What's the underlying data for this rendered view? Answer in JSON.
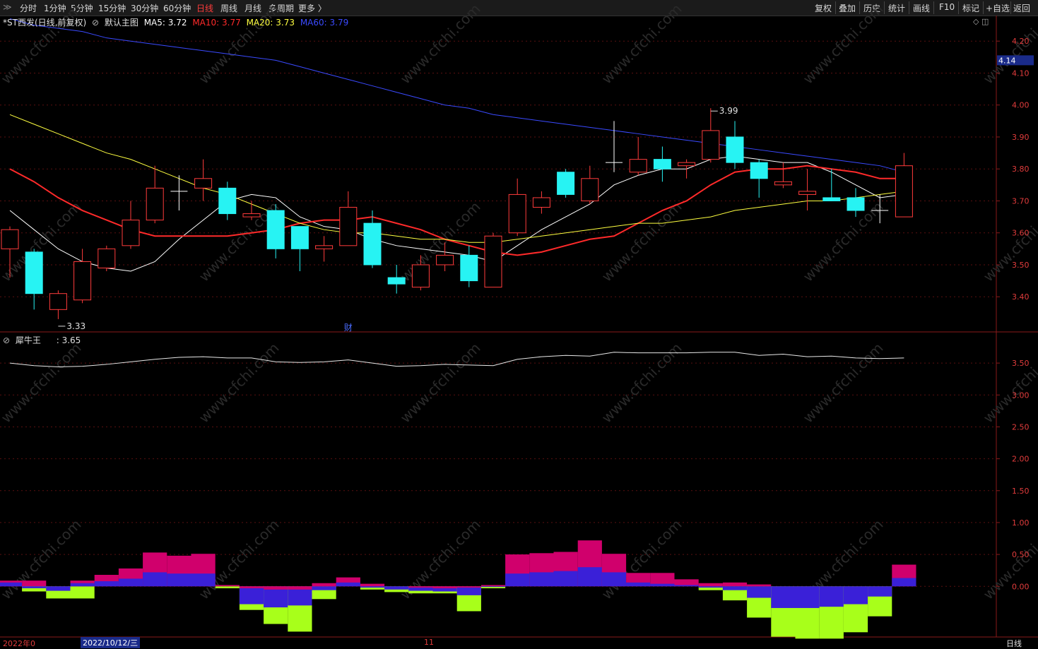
{
  "toolbar": {
    "left_tabs": [
      "分时",
      "1分钟",
      "5分钟",
      "15分钟",
      "30分钟",
      "60分钟",
      "日线",
      "周线",
      "月线",
      "多周期",
      "更多 〉"
    ],
    "active_tab": "日线",
    "right_tabs": [
      "复权",
      "叠加",
      "历史",
      "统计",
      "画线",
      "F10",
      "标记",
      "+自选",
      "返回"
    ]
  },
  "main_legend": {
    "title": "*ST西发(日线,前复权)",
    "template": "默认主图",
    "ma5": "MA5: 3.72",
    "ma10": "MA10: 3.77",
    "ma20": "MA20: 3.73",
    "ma60": "MA60: 3.79",
    "colors": {
      "ma5": "#ffffff",
      "ma10": "#ff2a2a",
      "ma20": "#ffff40",
      "ma60": "#3a4aff"
    }
  },
  "indicator_legend": {
    "name": "犀牛王",
    "value": ": 3.65"
  },
  "annotations": {
    "low_label": "3.33",
    "high_label": "3.99",
    "finance_marker": "财",
    "current_price_tag": "4.14"
  },
  "bottom_bar": {
    "left_date": "2022年0",
    "cursor_date": "2022/10/12/三",
    "month_mark": "11",
    "period": "日线"
  },
  "watermark": "www.cfchi.com",
  "chart_data": [
    {
      "type": "candlestick",
      "title": "*ST西发(日线,前复权)",
      "ylim": [
        3.29,
        4.28
      ],
      "y_ticks": [
        3.4,
        3.5,
        3.6,
        3.7,
        3.8,
        3.9,
        4.0,
        4.1,
        4.2
      ],
      "candles": [
        {
          "o": 3.55,
          "h": 3.62,
          "l": 3.46,
          "c": 3.61
        },
        {
          "o": 3.54,
          "h": 3.55,
          "l": 3.36,
          "c": 3.41
        },
        {
          "o": 3.36,
          "h": 3.42,
          "l": 3.33,
          "c": 3.41
        },
        {
          "o": 3.39,
          "h": 3.55,
          "l": 3.38,
          "c": 3.51
        },
        {
          "o": 3.49,
          "h": 3.56,
          "l": 3.48,
          "c": 3.55
        },
        {
          "o": 3.56,
          "h": 3.7,
          "l": 3.55,
          "c": 3.64
        },
        {
          "o": 3.64,
          "h": 3.81,
          "l": 3.63,
          "c": 3.74
        },
        {
          "o": 3.73,
          "h": 3.78,
          "l": 3.67,
          "c": 3.73
        },
        {
          "o": 3.74,
          "h": 3.83,
          "l": 3.7,
          "c": 3.77
        },
        {
          "o": 3.74,
          "h": 3.76,
          "l": 3.64,
          "c": 3.66
        },
        {
          "o": 3.65,
          "h": 3.7,
          "l": 3.64,
          "c": 3.66
        },
        {
          "o": 3.67,
          "h": 3.69,
          "l": 3.52,
          "c": 3.55
        },
        {
          "o": 3.62,
          "h": 3.62,
          "l": 3.48,
          "c": 3.55
        },
        {
          "o": 3.55,
          "h": 3.59,
          "l": 3.51,
          "c": 3.56
        },
        {
          "o": 3.56,
          "h": 3.73,
          "l": 3.56,
          "c": 3.68
        },
        {
          "o": 3.63,
          "h": 3.67,
          "l": 3.49,
          "c": 3.5
        },
        {
          "o": 3.46,
          "h": 3.5,
          "l": 3.41,
          "c": 3.44
        },
        {
          "o": 3.43,
          "h": 3.53,
          "l": 3.42,
          "c": 3.5
        },
        {
          "o": 3.5,
          "h": 3.57,
          "l": 3.48,
          "c": 3.53
        },
        {
          "o": 3.53,
          "h": 3.56,
          "l": 3.43,
          "c": 3.45
        },
        {
          "o": 3.43,
          "h": 3.6,
          "l": 3.43,
          "c": 3.59
        },
        {
          "o": 3.6,
          "h": 3.77,
          "l": 3.59,
          "c": 3.72
        },
        {
          "o": 3.68,
          "h": 3.73,
          "l": 3.66,
          "c": 3.71
        },
        {
          "o": 3.79,
          "h": 3.8,
          "l": 3.71,
          "c": 3.72
        },
        {
          "o": 3.7,
          "h": 3.81,
          "l": 3.69,
          "c": 3.77
        },
        {
          "o": 3.82,
          "h": 3.95,
          "l": 3.79,
          "c": 3.82
        },
        {
          "o": 3.79,
          "h": 3.9,
          "l": 3.78,
          "c": 3.83
        },
        {
          "o": 3.83,
          "h": 3.87,
          "l": 3.76,
          "c": 3.8
        },
        {
          "o": 3.81,
          "h": 3.83,
          "l": 3.77,
          "c": 3.82
        },
        {
          "o": 3.83,
          "h": 3.99,
          "l": 3.82,
          "c": 3.92
        },
        {
          "o": 3.9,
          "h": 3.95,
          "l": 3.8,
          "c": 3.82
        },
        {
          "o": 3.82,
          "h": 3.83,
          "l": 3.71,
          "c": 3.77
        },
        {
          "o": 3.75,
          "h": 3.82,
          "l": 3.74,
          "c": 3.76
        },
        {
          "o": 3.72,
          "h": 3.8,
          "l": 3.67,
          "c": 3.73
        },
        {
          "o": 3.71,
          "h": 3.8,
          "l": 3.7,
          "c": 3.7
        },
        {
          "o": 3.71,
          "h": 3.74,
          "l": 3.65,
          "c": 3.67
        },
        {
          "o": 3.67,
          "h": 3.72,
          "l": 3.63,
          "c": 3.67
        },
        {
          "o": 3.65,
          "h": 3.85,
          "l": 3.65,
          "c": 3.81
        }
      ],
      "series": [
        {
          "name": "MA5",
          "color": "#ffffff",
          "values": [
            3.67,
            3.61,
            3.55,
            3.51,
            3.49,
            3.48,
            3.51,
            3.58,
            3.64,
            3.7,
            3.72,
            3.71,
            3.65,
            3.62,
            3.61,
            3.58,
            3.56,
            3.55,
            3.54,
            3.53,
            3.51,
            3.56,
            3.61,
            3.65,
            3.69,
            3.75,
            3.78,
            3.8,
            3.8,
            3.83,
            3.84,
            3.83,
            3.82,
            3.82,
            3.79,
            3.75,
            3.71,
            3.72
          ]
        },
        {
          "name": "MA10",
          "color": "#ff2a2a",
          "values": [
            3.8,
            3.76,
            3.71,
            3.67,
            3.64,
            3.61,
            3.59,
            3.59,
            3.59,
            3.59,
            3.6,
            3.61,
            3.63,
            3.64,
            3.64,
            3.65,
            3.63,
            3.61,
            3.58,
            3.56,
            3.54,
            3.53,
            3.54,
            3.56,
            3.58,
            3.59,
            3.63,
            3.67,
            3.7,
            3.75,
            3.79,
            3.8,
            3.8,
            3.81,
            3.8,
            3.79,
            3.77,
            3.77
          ]
        },
        {
          "name": "MA20",
          "color": "#ffff40",
          "values": [
            3.97,
            3.94,
            3.91,
            3.88,
            3.85,
            3.83,
            3.8,
            3.77,
            3.74,
            3.72,
            3.69,
            3.66,
            3.63,
            3.61,
            3.6,
            3.6,
            3.59,
            3.58,
            3.58,
            3.57,
            3.57,
            3.58,
            3.59,
            3.6,
            3.61,
            3.62,
            3.63,
            3.63,
            3.64,
            3.65,
            3.67,
            3.68,
            3.69,
            3.7,
            3.7,
            3.71,
            3.72,
            3.73
          ]
        },
        {
          "name": "MA60",
          "color": "#3a4aff",
          "values": [
            4.27,
            4.25,
            4.24,
            4.23,
            4.21,
            4.2,
            4.19,
            4.18,
            4.17,
            4.16,
            4.15,
            4.14,
            4.12,
            4.1,
            4.08,
            4.06,
            4.04,
            4.02,
            4.0,
            3.99,
            3.97,
            3.96,
            3.95,
            3.94,
            3.93,
            3.92,
            3.91,
            3.9,
            3.89,
            3.88,
            3.87,
            3.86,
            3.85,
            3.84,
            3.83,
            3.82,
            3.81,
            3.79
          ]
        }
      ]
    },
    {
      "type": "line",
      "title": "犀牛王",
      "ylim": [
        -0.75,
        3.9
      ],
      "y_ticks": [
        3.5,
        3.0,
        2.5,
        2.0,
        1.5,
        1.0,
        0.5,
        0.0
      ],
      "series": [
        {
          "name": "犀牛王",
          "color": "#e8e8e8",
          "values": [
            3.5,
            3.46,
            3.44,
            3.45,
            3.48,
            3.52,
            3.56,
            3.59,
            3.6,
            3.58,
            3.58,
            3.52,
            3.51,
            3.52,
            3.55,
            3.5,
            3.45,
            3.46,
            3.48,
            3.47,
            3.46,
            3.56,
            3.6,
            3.62,
            3.61,
            3.67,
            3.66,
            3.66,
            3.66,
            3.67,
            3.67,
            3.62,
            3.64,
            3.6,
            3.61,
            3.58,
            3.57,
            3.58
          ]
        }
      ]
    },
    {
      "type": "bar",
      "title": "",
      "ylim": [
        -0.75,
        3.9
      ],
      "series": [
        {
          "name": "",
          "color": "#d0006c",
          "values": [
            0.09,
            0.09,
            0.0,
            0.09,
            0.18,
            0.28,
            0.53,
            0.48,
            0.51,
            0.02,
            -0.03,
            -0.05,
            -0.05,
            0.05,
            0.14,
            0.04,
            0.0,
            -0.02,
            -0.03,
            -0.02,
            0.02,
            0.5,
            0.52,
            0.54,
            0.72,
            0.51,
            0.21,
            0.21,
            0.11,
            0.05,
            0.06,
            0.03,
            0.0,
            0.0,
            0.0,
            0.0,
            0.0,
            0.34
          ]
        },
        {
          "name": "",
          "color": "#3a20d8",
          "values": [
            0.06,
            -0.03,
            -0.07,
            0.05,
            0.08,
            0.12,
            0.22,
            0.2,
            0.2,
            0.0,
            -0.28,
            -0.33,
            -0.3,
            -0.06,
            0.06,
            -0.02,
            -0.05,
            -0.07,
            -0.08,
            -0.14,
            -0.01,
            0.2,
            0.22,
            0.24,
            0.3,
            0.22,
            0.06,
            0.04,
            0.02,
            -0.02,
            -0.06,
            -0.18,
            -0.34,
            -0.34,
            -0.32,
            -0.28,
            -0.16,
            0.13
          ]
        },
        {
          "name": "",
          "color": "#a8ff1a",
          "values": [
            0.0,
            -0.08,
            -0.19,
            -0.19,
            0.0,
            0.0,
            0.0,
            0.0,
            0.0,
            -0.03,
            -0.37,
            -0.59,
            -0.71,
            -0.2,
            0.0,
            -0.05,
            -0.09,
            -0.11,
            -0.11,
            -0.39,
            -0.03,
            0.0,
            0.0,
            0.0,
            0.0,
            0.0,
            0.0,
            0.0,
            0.0,
            -0.06,
            -0.22,
            -0.49,
            -0.79,
            -0.82,
            -0.82,
            -0.72,
            -0.47,
            0.0
          ]
        }
      ]
    }
  ]
}
